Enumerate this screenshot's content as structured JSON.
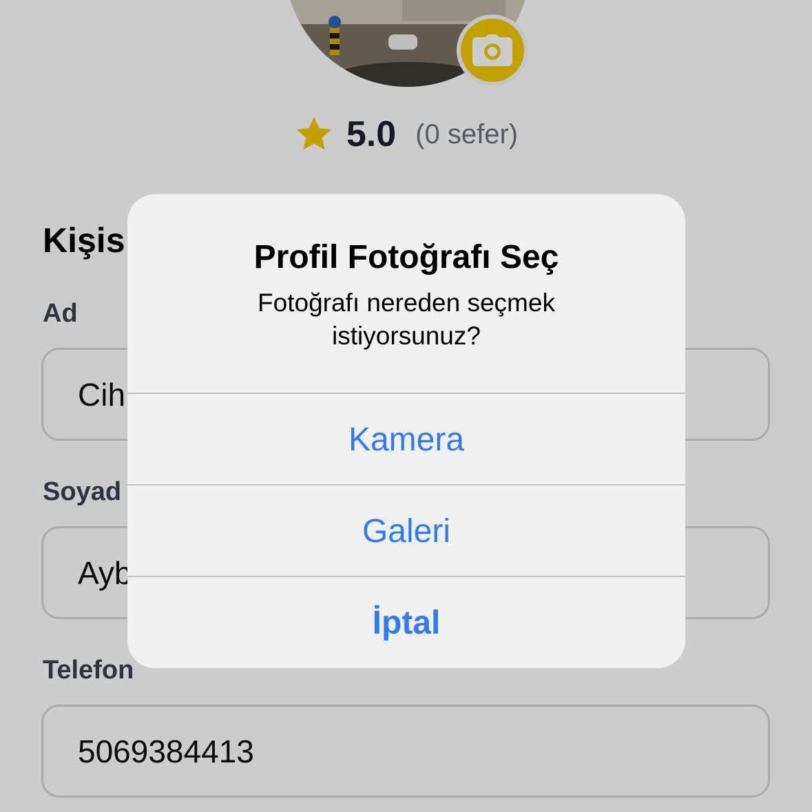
{
  "colors": {
    "accent_yellow": "#f2c800",
    "star": "#f2c800",
    "alert_action_blue": "#2f7bf0",
    "background": "#ffffff"
  },
  "profile": {
    "photo_icon": "camera-icon",
    "rating": "5.0",
    "trip_count": "(0 sefer)"
  },
  "form": {
    "section_title": "Kişis",
    "first_name": {
      "label": "Ad",
      "value": "Cih"
    },
    "last_name": {
      "label": "Soyad",
      "value": "Ayb"
    },
    "phone": {
      "label": "Telefon",
      "value": "5069384413"
    }
  },
  "alert": {
    "title": "Profil Fotoğrafı Seç",
    "message": "Fotoğrafı nereden seçmek istiyorsunuz?",
    "actions": [
      {
        "label": "Kamera"
      },
      {
        "label": "Galeri"
      },
      {
        "label": "İptal"
      }
    ]
  }
}
